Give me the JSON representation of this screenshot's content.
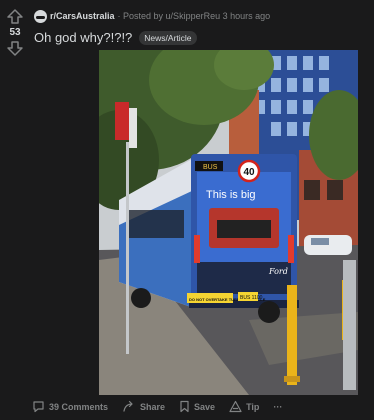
{
  "post": {
    "vote_count": "53",
    "subreddit": "r/CarsAustralia",
    "posted_by": "· Posted by u/SkipperReu 3 hours ago",
    "title": "Oh god why?!?!?",
    "flair": "News/Article"
  },
  "image": {
    "speed_sign": "40",
    "ad_headline": "This is big",
    "ad_brand": "Ford",
    "plate": "BUS 1100",
    "bus_notice": "DO NOT OVERTAKE TURNING VEHICLE"
  },
  "actions": {
    "comments": "39 Comments",
    "share": "Share",
    "save": "Save",
    "tip": "Tip",
    "more": "···"
  },
  "colors": {
    "background": "#1a1a1b",
    "text": "#d7dadc",
    "muted": "#818384",
    "flair_bg": "#343536"
  }
}
